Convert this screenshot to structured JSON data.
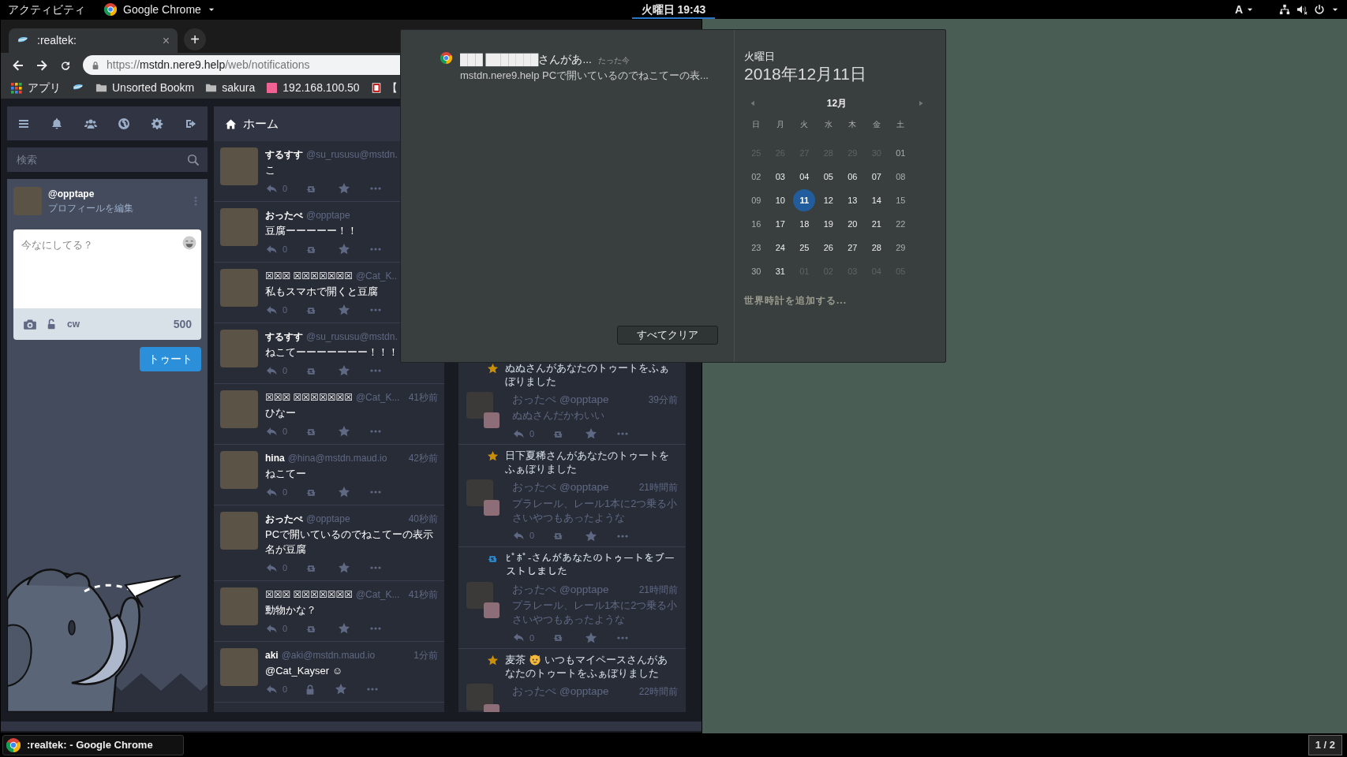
{
  "top_bar": {
    "activities": "アクティビティ",
    "app_menu": "Google Chrome",
    "clock": "火曜日 19:43",
    "clock_selected": true,
    "input_method": "A"
  },
  "browser": {
    "tabs": [
      {
        "title": ":realtek:",
        "close": "×",
        "selected": true
      }
    ],
    "new_tab": "+",
    "address": {
      "scheme": "https://",
      "host": "mstdn.nere9.help",
      "path": "/web/notifications"
    },
    "bookmarks": [
      {
        "kind": "apps",
        "label": "アプリ"
      },
      {
        "kind": "favicon"
      },
      {
        "kind": "folder",
        "label": "Unsorted Bookm"
      },
      {
        "kind": "folder",
        "label": "sakura"
      },
      {
        "kind": "site",
        "label": "192.168.100.50"
      },
      {
        "kind": "site-r",
        "label": "【"
      }
    ]
  },
  "drawer": {
    "search_placeholder": "検索",
    "account": {
      "handle": "@opptape",
      "edit_link": "プロフィールを編集"
    },
    "compose": {
      "placeholder": "今なにしてる？",
      "cw": "cw",
      "counter": "500",
      "submit": "トゥート"
    }
  },
  "home": {
    "title": "ホーム",
    "toots": [
      {
        "kind": "public",
        "name": "するすす",
        "handle": "@su_rususu@mstdn.",
        "content": "こ",
        "replies": "0"
      },
      {
        "kind": "public",
        "name": "おったぺ",
        "handle": "@opptape",
        "content": "豆腐ーーーーー！！",
        "replies": "0"
      },
      {
        "kind": "public",
        "name": "☒☒☒ ☒☒☒☒☒☒☒",
        "handle": "@Cat_K..",
        "content": "私もスマホで開くと豆腐",
        "replies": "0"
      },
      {
        "kind": "public",
        "name": "するすす",
        "handle": "@su_rususu@mstdn.",
        "content": "ねこてーーーーーーー！！！",
        "replies": "0"
      },
      {
        "kind": "public",
        "name": "☒☒☒ ☒☒☒☒☒☒☒",
        "handle": "@Cat_K...",
        "time": "41秒前",
        "content": "ひなー",
        "replies": "0"
      },
      {
        "kind": "public",
        "name": "hina",
        "handle": "@hina@mstdn.maud.io",
        "time": "42秒前",
        "content": "ねこてー",
        "replies": "0"
      },
      {
        "kind": "public",
        "name": "おったぺ",
        "handle": "@opptape",
        "time": "40秒前",
        "content": "PCで開いているのでねこてーの表示名が豆腐",
        "replies": "0"
      },
      {
        "kind": "public",
        "name": "☒☒☒ ☒☒☒☒☒☒☒",
        "handle": "@Cat_K...",
        "time": "41秒前",
        "content": "動物かな？",
        "replies": "0"
      },
      {
        "kind": "private",
        "name": "aki",
        "handle": "@aki@mstdn.maud.io",
        "time": "1分前",
        "content": "@Cat_Kayser ☺",
        "replies": "0"
      }
    ]
  },
  "notifications": {
    "items": [
      {
        "kind": "favourite",
        "message": [
          {
            "kind": "text",
            "text": "ぬぬさんがあなたのトゥートをふぁぼりました"
          }
        ],
        "status": {
          "name": "おったぺ",
          "handle": "@opptape",
          "time": "39分前",
          "content": "ぬぬさんだかわいい",
          "replies": "0"
        }
      },
      {
        "kind": "favourite",
        "message": [
          {
            "kind": "text",
            "text": "日下夏稀さんがあなたのトゥートをふぁぼりました"
          }
        ],
        "status": {
          "name": "おったぺ",
          "handle": "@opptape",
          "time": "21時間前",
          "content": "プラレール、レール1本に2つ乗る小さいやつもあったような",
          "replies": "0"
        }
      },
      {
        "kind": "boost",
        "message": [
          {
            "kind": "text",
            "text": "ﾋﾟﾎﾟ-さんがあなたのトゥートをブーストしました"
          }
        ],
        "status": {
          "name": "おったぺ",
          "handle": "@opptape",
          "time": "21時間前",
          "content": "プラレール、レール1本に2つ乗る小さいやつもあったような",
          "replies": "0"
        }
      },
      {
        "kind": "favourite",
        "message": [
          {
            "kind": "text",
            "text": "麦茶"
          },
          {
            "kind": "emoji"
          },
          {
            "kind": "text",
            "text": "いつもマイペースさんがあ"
          },
          {
            "kind": "text",
            "text": "なたのトゥートをふぁぼりました"
          }
        ],
        "status": {
          "name": "おったぺ",
          "handle": "@opptape",
          "time": "22時間前"
        }
      }
    ]
  },
  "notification_panel": {
    "notifications": [
      {
        "title": "███ ███████さんがあ...",
        "time": "たった今",
        "body": "mstdn.nere9.help PCで開いているのでねこてーの表..."
      }
    ],
    "clear_button": "すべてクリア",
    "calendar": {
      "weekday": "火曜日",
      "date": "2018年12月11日",
      "month": "12月",
      "day_names": [
        "日",
        "月",
        "火",
        "水",
        "木",
        "金",
        "土"
      ],
      "weeks": [
        [
          {
            "label": "25",
            "kind": "other",
            "selected": false
          },
          {
            "label": "26",
            "kind": "other",
            "selected": false
          },
          {
            "label": "27",
            "kind": "other",
            "selected": false
          },
          {
            "label": "28",
            "kind": "other",
            "selected": false
          },
          {
            "label": "29",
            "kind": "other",
            "selected": false
          },
          {
            "label": "30",
            "kind": "other",
            "selected": false
          },
          {
            "label": "01",
            "kind": "weekend",
            "selected": false
          }
        ],
        [
          {
            "label": "02",
            "kind": "weekend",
            "selected": false
          },
          {
            "label": "03",
            "kind": "weekday",
            "selected": false
          },
          {
            "label": "04",
            "kind": "weekday",
            "selected": false
          },
          {
            "label": "05",
            "kind": "weekday",
            "selected": false
          },
          {
            "label": "06",
            "kind": "weekday",
            "selected": false
          },
          {
            "label": "07",
            "kind": "weekday",
            "selected": false
          },
          {
            "label": "08",
            "kind": "weekend",
            "selected": false
          }
        ],
        [
          {
            "label": "09",
            "kind": "weekend",
            "selected": false
          },
          {
            "label": "10",
            "kind": "weekday",
            "selected": false
          },
          {
            "label": "11",
            "kind": "weekday",
            "selected": true
          },
          {
            "label": "12",
            "kind": "weekday",
            "selected": false
          },
          {
            "label": "13",
            "kind": "weekday",
            "selected": false
          },
          {
            "label": "14",
            "kind": "weekday",
            "selected": false
          },
          {
            "label": "15",
            "kind": "weekend",
            "selected": false
          }
        ],
        [
          {
            "label": "16",
            "kind": "weekend",
            "selected": false
          },
          {
            "label": "17",
            "kind": "weekday",
            "selected": false
          },
          {
            "label": "18",
            "kind": "weekday",
            "selected": false
          },
          {
            "label": "19",
            "kind": "weekday",
            "selected": false
          },
          {
            "label": "20",
            "kind": "weekday",
            "selected": false
          },
          {
            "label": "21",
            "kind": "weekday",
            "selected": false
          },
          {
            "label": "22",
            "kind": "weekend",
            "selected": false
          }
        ],
        [
          {
            "label": "23",
            "kind": "weekend",
            "selected": false
          },
          {
            "label": "24",
            "kind": "weekday",
            "selected": false
          },
          {
            "label": "25",
            "kind": "weekday",
            "selected": false
          },
          {
            "label": "26",
            "kind": "weekday",
            "selected": false
          },
          {
            "label": "27",
            "kind": "weekday",
            "selected": false
          },
          {
            "label": "28",
            "kind": "weekday",
            "selected": false
          },
          {
            "label": "29",
            "kind": "weekend",
            "selected": false
          }
        ],
        [
          {
            "label": "30",
            "kind": "weekend",
            "selected": false
          },
          {
            "label": "31",
            "kind": "weekday",
            "selected": false
          },
          {
            "label": "01",
            "kind": "other",
            "selected": false
          },
          {
            "label": "02",
            "kind": "other",
            "selected": false
          },
          {
            "label": "03",
            "kind": "other",
            "selected": false
          },
          {
            "label": "04",
            "kind": "other",
            "selected": false
          },
          {
            "label": "05",
            "kind": "other",
            "selected": false
          }
        ]
      ]
    },
    "world_clocks": "世界時計を追加する..."
  },
  "taskbar": {
    "windows": [
      {
        "title": ":realtek: - Google Chrome",
        "selected": false
      }
    ],
    "workspace": "1 / 2"
  }
}
